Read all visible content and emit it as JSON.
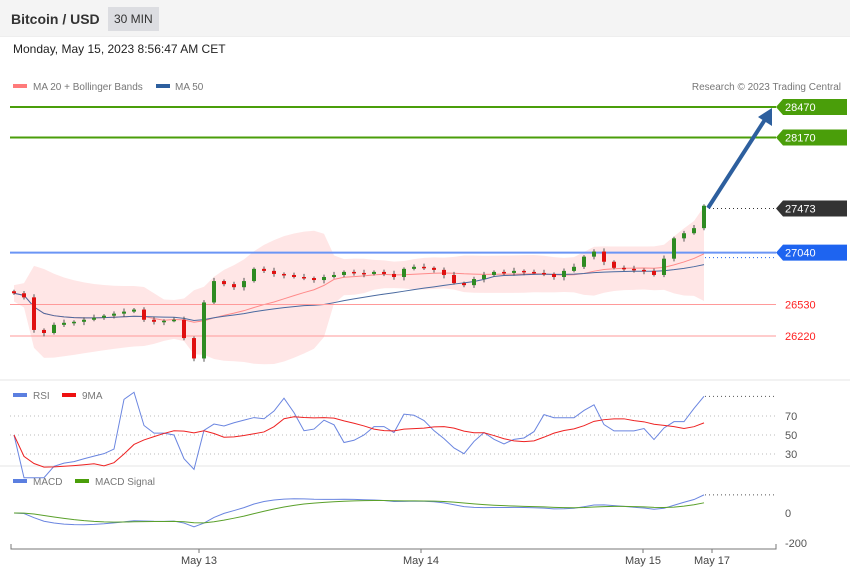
{
  "header": {
    "title": "Bitcoin / USD",
    "timeframe": "30 MIN"
  },
  "date": "Monday, May 15, 2023 8:56:47 AM CET",
  "legend": {
    "ma20": "MA 20 + Bollinger Bands",
    "ma50": "MA 50",
    "rsi": "RSI",
    "rsi_ma": "9MA",
    "macd": "MACD",
    "macd_signal": "MACD Signal"
  },
  "credit": "Research © 2023 Trading Central",
  "colors": {
    "target": "#4a9e0a",
    "pivot": "#1e64f0",
    "support": "#ff2020",
    "current": "#333333",
    "arrow": "#2d5f9e",
    "up": "#2e8b22",
    "down": "#e01010"
  },
  "chart_data": {
    "type": "candlestick",
    "levels": {
      "resistance": [
        28470,
        28170
      ],
      "current": 27473,
      "pivot": 27040,
      "support": [
        26530,
        26220
      ]
    },
    "level_labels": {
      "r2": "28470",
      "r1": "28170",
      "current": "27473",
      "pivot": "27040",
      "s1": "26530",
      "s2": "26220"
    },
    "closes": [
      26640,
      26600,
      26280,
      26250,
      26330,
      26350,
      26360,
      26380,
      26400,
      26420,
      26440,
      26460,
      26480,
      26380,
      26360,
      26370,
      26380,
      26200,
      26000,
      26550,
      26760,
      26730,
      26700,
      26760,
      26880,
      26860,
      26830,
      26820,
      26800,
      26790,
      26770,
      26800,
      26820,
      26850,
      26840,
      26830,
      26850,
      26830,
      26800,
      26880,
      26900,
      26890,
      26870,
      26820,
      26740,
      26720,
      26780,
      26820,
      26850,
      26840,
      26860,
      26850,
      26840,
      26830,
      26800,
      26860,
      26900,
      27000,
      27050,
      26950,
      26890,
      26880,
      26870,
      26860,
      26820,
      26980,
      27180,
      27230,
      27280,
      27500
    ],
    "x_labels": [
      {
        "label": "May 13",
        "index": 18.5
      },
      {
        "label": "May 14",
        "index": 40.7
      },
      {
        "label": "May 15",
        "index": 62.9
      },
      {
        "label": "May 17",
        "index": 69.8
      }
    ],
    "rsi_ticks": [
      "70",
      "50",
      "30"
    ],
    "macd_ticks": [
      "0",
      "-200"
    ]
  }
}
